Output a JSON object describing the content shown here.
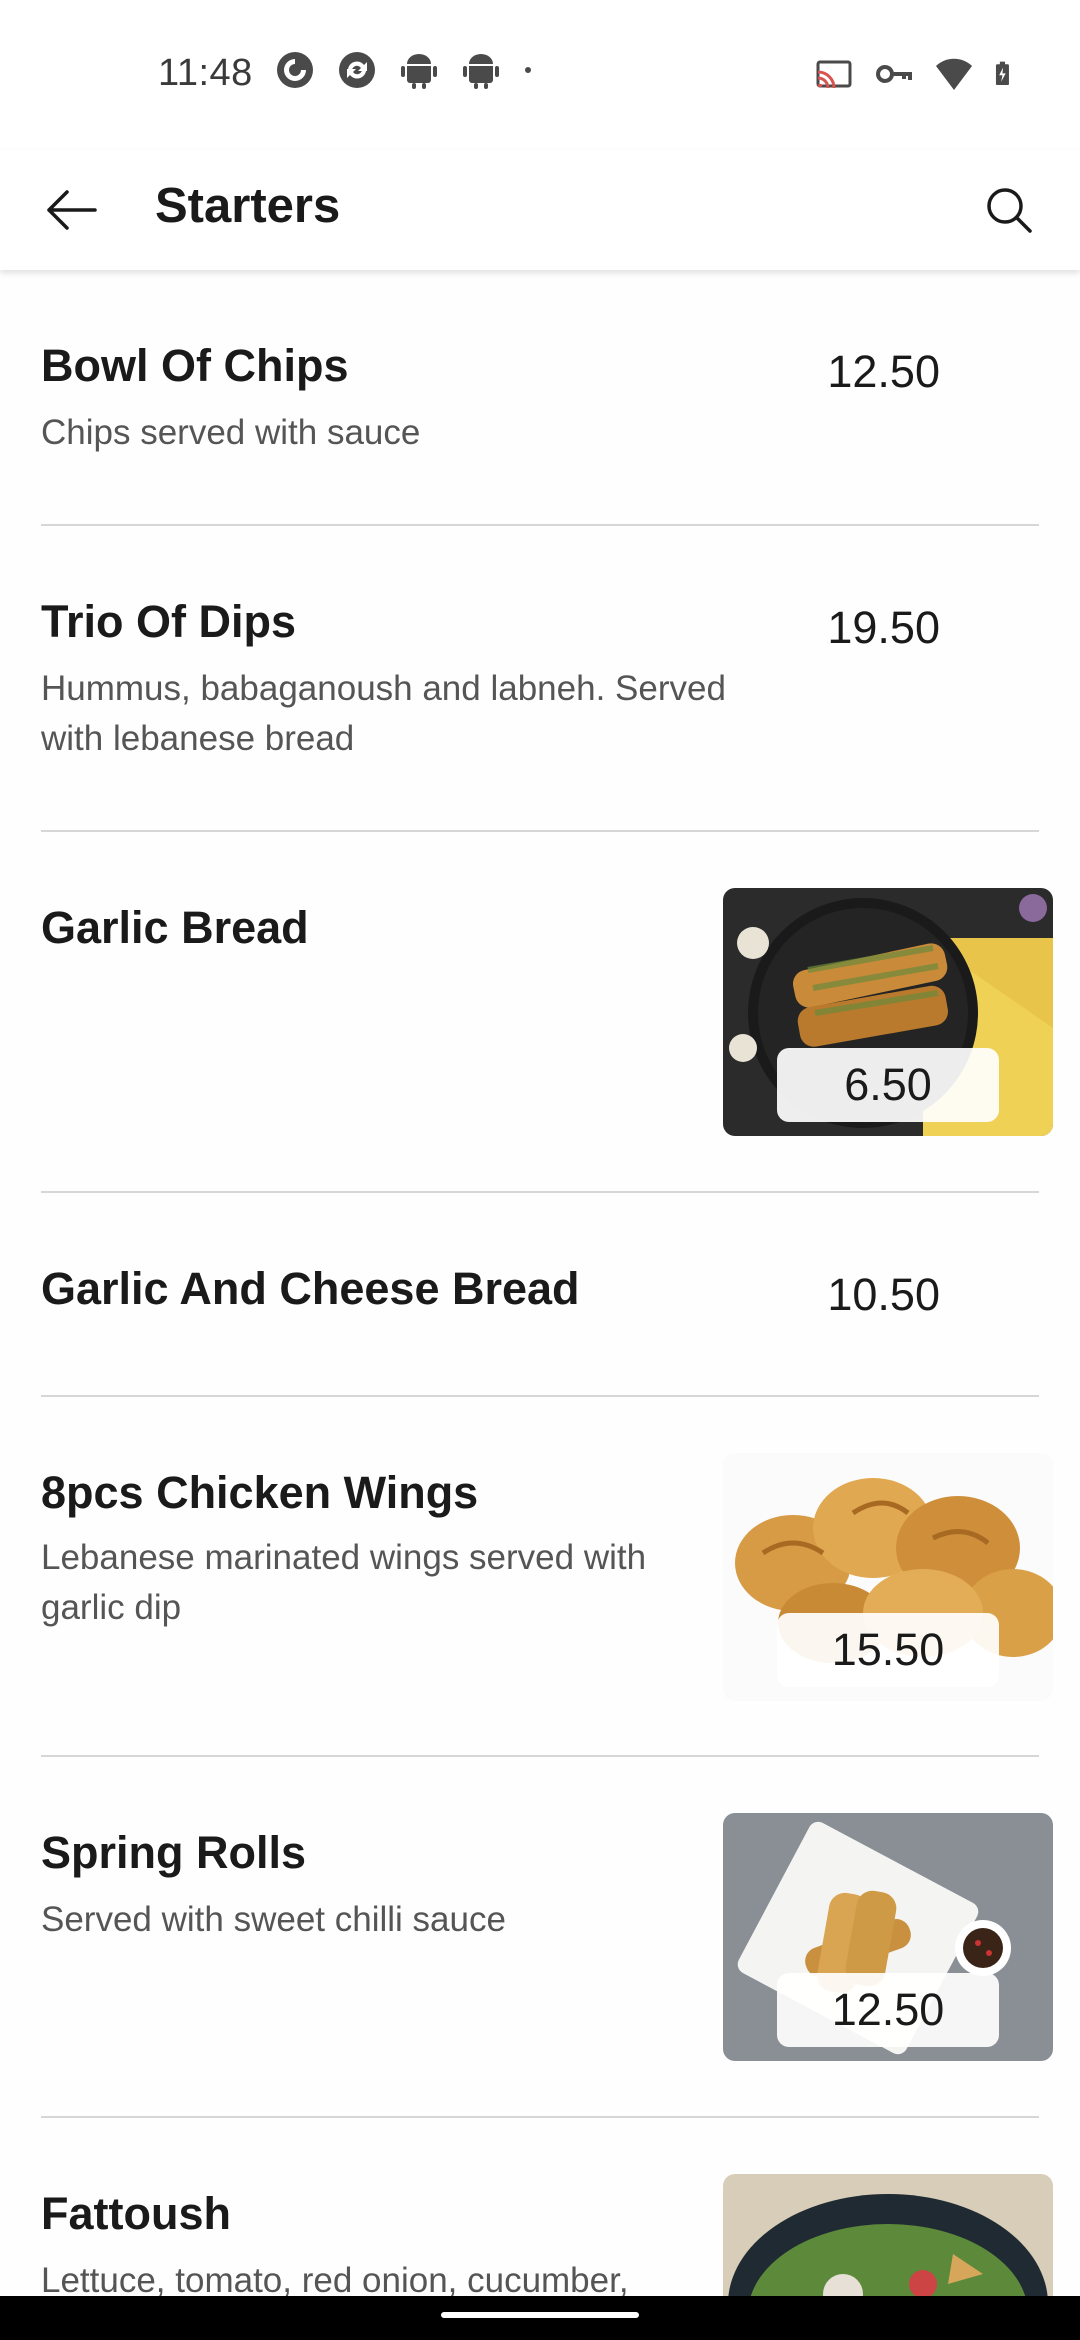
{
  "status_bar": {
    "time": "11:48",
    "left_icons": [
      "pocket-casts-icon",
      "sync-icon",
      "android-icon",
      "android-icon",
      "dot-icon"
    ],
    "right_icons": [
      "cast-icon",
      "vpn-key-icon",
      "wifi-icon",
      "battery-charging-icon"
    ]
  },
  "app_bar": {
    "title": "Starters",
    "back_icon": "arrow-left-icon",
    "search_icon": "search-icon"
  },
  "items": [
    {
      "name": "Bowl Of Chips",
      "description": "Chips served with sauce",
      "price": "12.50",
      "has_image": false
    },
    {
      "name": "Trio Of Dips",
      "description": "Hummus, babaganoush and labneh. Served with lebanese bread",
      "price": "19.50",
      "has_image": false
    },
    {
      "name": "Garlic Bread",
      "description": "",
      "price": "6.50",
      "has_image": true,
      "image": "garlic-bread-photo"
    },
    {
      "name": "Garlic And Cheese Bread",
      "description": "",
      "price": "10.50",
      "has_image": false
    },
    {
      "name": "8pcs Chicken Wings",
      "description": "Lebanese marinated wings served with garlic dip",
      "price": "15.50",
      "has_image": true,
      "image": "chicken-wings-photo"
    },
    {
      "name": "Spring Rolls",
      "description": "Served with sweet chilli sauce",
      "price": "12.50",
      "has_image": true,
      "image": "spring-rolls-photo"
    },
    {
      "name": "Fattoush",
      "description": "Lettuce, tomato, red onion, cucumber,",
      "price": "",
      "has_image": true,
      "image": "fattoush-photo"
    }
  ],
  "colors": {
    "text_primary": "#1a1a1a",
    "text_secondary": "#555555",
    "divider": "#d6d6d6",
    "background": "#ffffff"
  }
}
